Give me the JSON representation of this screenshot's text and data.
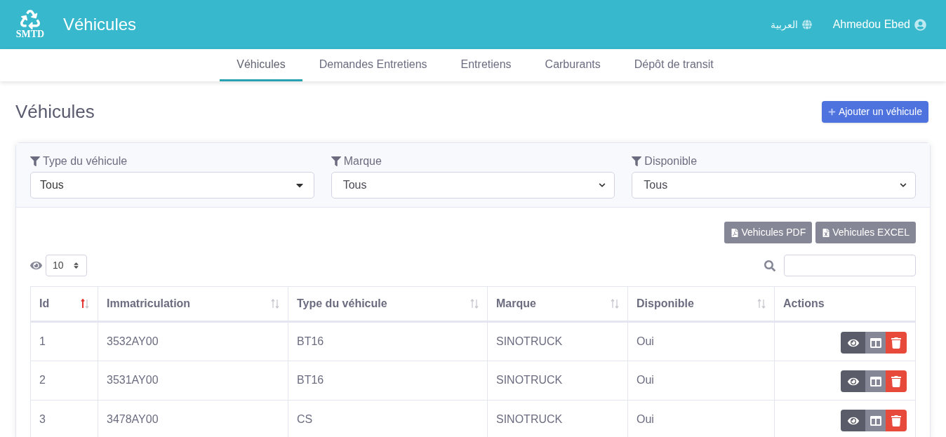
{
  "header": {
    "logo_text": "SMTD",
    "title": "Véhicules",
    "language": "العربية",
    "user": "Ahmedou Ebed"
  },
  "tabs": [
    {
      "label": "Véhicules",
      "selected": true
    },
    {
      "label": "Demandes Entretiens",
      "selected": false
    },
    {
      "label": "Entretiens",
      "selected": false
    },
    {
      "label": "Carburants",
      "selected": false
    },
    {
      "label": "Dépôt de transit",
      "selected": false
    }
  ],
  "page_title": "Véhicules",
  "add_button": "Ajouter un véhicule",
  "filters": [
    {
      "label": "Type du véhicule",
      "value": "Tous",
      "kind": "custom"
    },
    {
      "label": "Marque",
      "value": "Tous",
      "kind": "native"
    },
    {
      "label": "Disponible",
      "value": "Tous",
      "kind": "native"
    }
  ],
  "export_buttons": [
    {
      "label": "Vehicules PDF",
      "kind": "pdf"
    },
    {
      "label": "Vehicules EXCEL",
      "kind": "excel"
    }
  ],
  "page_size": "10",
  "table": {
    "columns": [
      {
        "label": "Id",
        "sortable": true,
        "sorted": true
      },
      {
        "label": "Immatriculation",
        "sortable": true,
        "sorted": false
      },
      {
        "label": "Type du véhicule",
        "sortable": true,
        "sorted": false
      },
      {
        "label": "Marque",
        "sortable": true,
        "sorted": false
      },
      {
        "label": "Disponible",
        "sortable": true,
        "sorted": false
      },
      {
        "label": "Actions",
        "sortable": false
      }
    ],
    "rows": [
      [
        "1",
        "3532AY00",
        "BT16",
        "SINOTRUCK",
        "Oui"
      ],
      [
        "2",
        "3531AY00",
        "BT16",
        "SINOTRUCK",
        "Oui"
      ],
      [
        "3",
        "3478AY00",
        "CS",
        "SINOTRUCK",
        "Oui"
      ]
    ]
  }
}
